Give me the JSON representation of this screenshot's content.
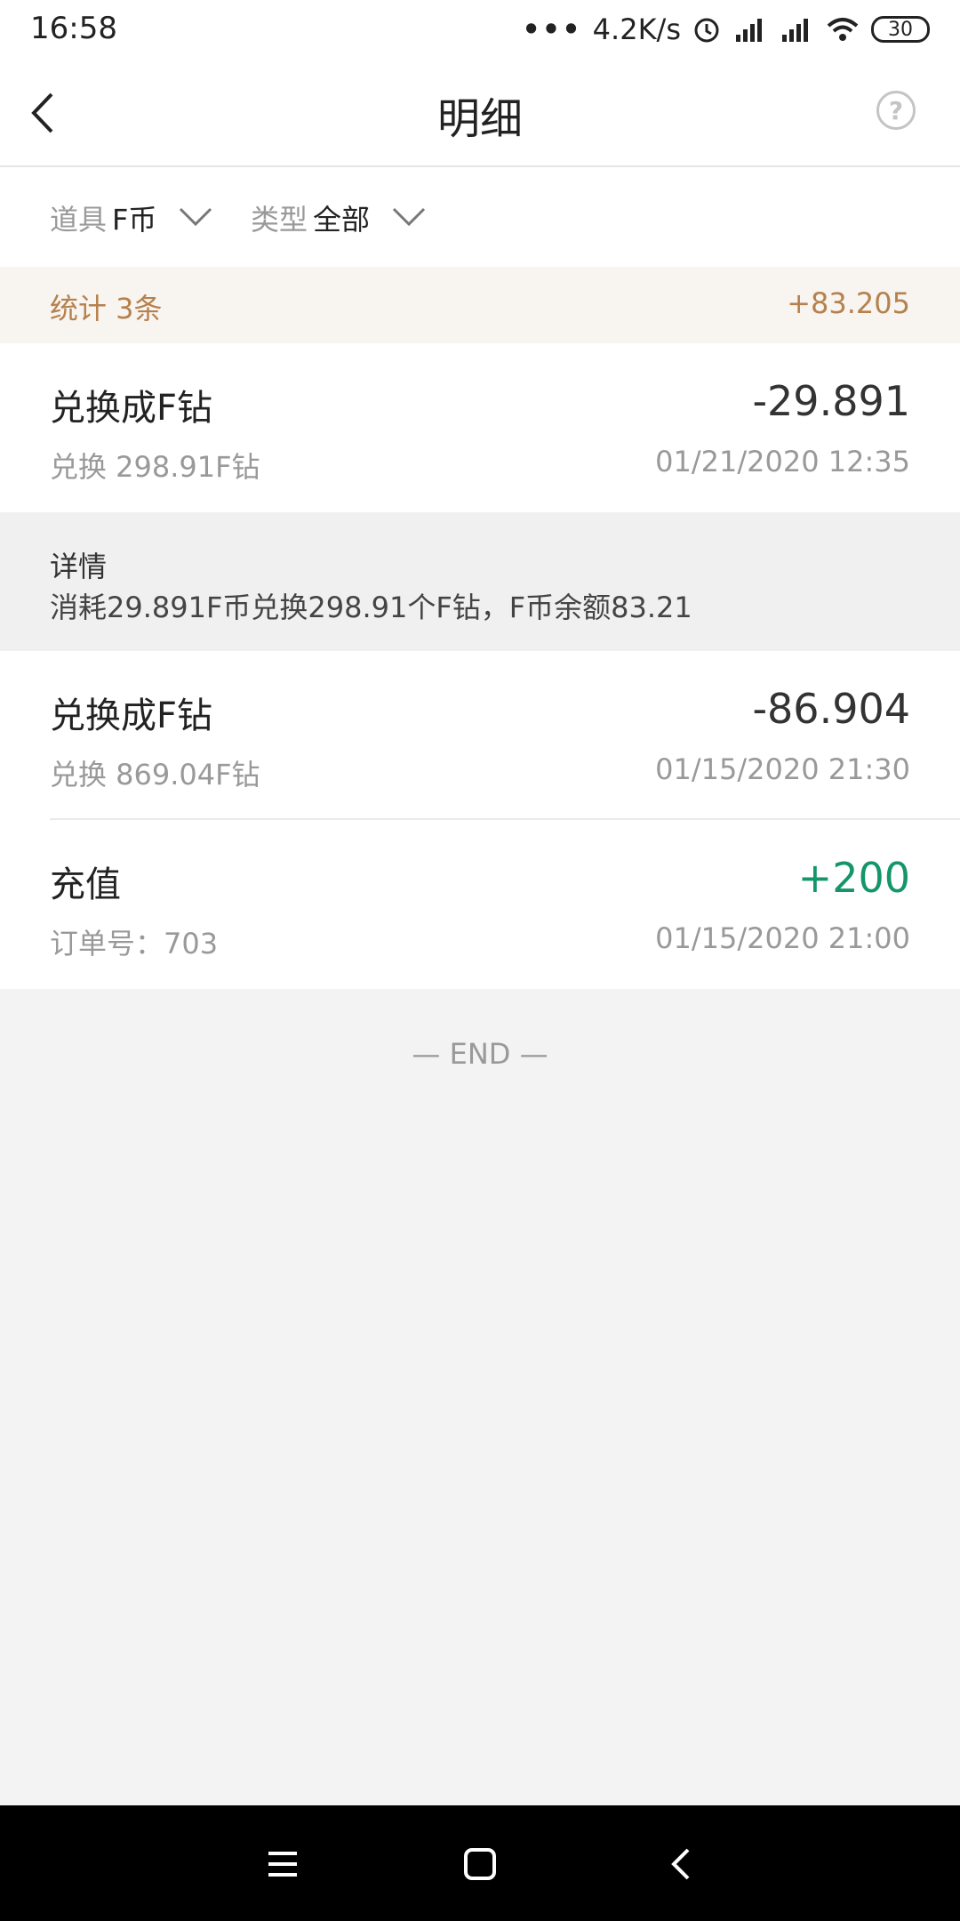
{
  "status_bar": {
    "time": "16:58",
    "dots": "•••",
    "net_speed": "4.2K/s",
    "battery": "30",
    "icons": [
      "alarm-icon",
      "signal-hd-icon",
      "signal-hd-icon",
      "wifi-icon",
      "battery-icon"
    ]
  },
  "header": {
    "title": "明细",
    "back_icon": "back-arrow-icon",
    "help_icon": "help-circle-icon",
    "help_glyph": "?"
  },
  "filters": {
    "item_label": "道具",
    "item_value": "F币",
    "type_label": "类型",
    "type_value": "全部"
  },
  "summary": {
    "count_text": "统计 3条",
    "total": "+83.205"
  },
  "records": [
    {
      "title": "兑换成F钻",
      "subtitle": "兑换 298.91F钻",
      "amount": "-29.891",
      "datetime": "01/21/2020 12:35"
    },
    {
      "title": "兑换成F钻",
      "subtitle": "兑换 869.04F钻",
      "amount": "-86.904",
      "datetime": "01/15/2020 21:30"
    },
    {
      "title": "充值",
      "subtitle": "订单号：703",
      "amount": "+200",
      "datetime": "01/15/2020 21:00"
    }
  ],
  "detail": {
    "label": "详情",
    "text": "消耗29.891F币兑换298.91个F钻，F币余额83.21"
  },
  "end_text": "— END —",
  "colors": {
    "accent": "#b5814e",
    "summary_bg": "#f8f4ef",
    "positive": "#14956a",
    "page_bg": "#f3f3f3"
  }
}
